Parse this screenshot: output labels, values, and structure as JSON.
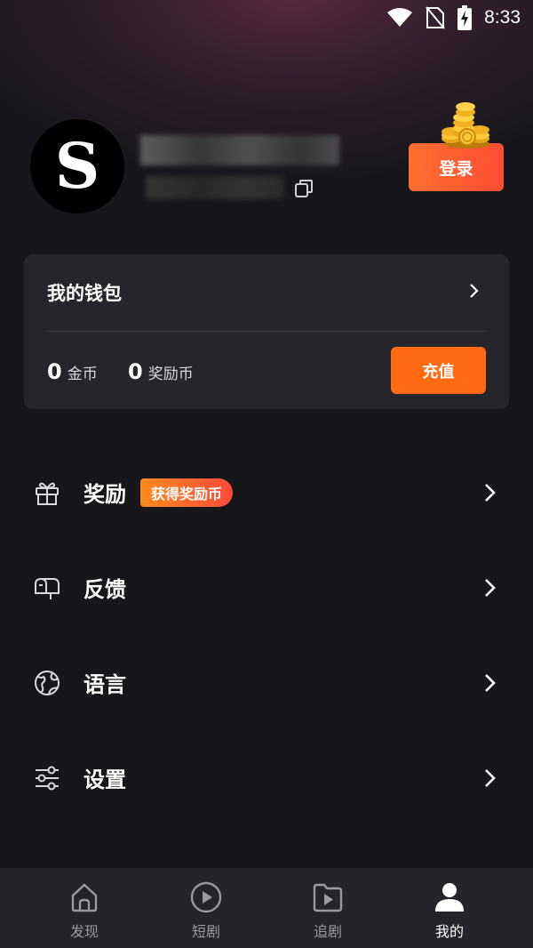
{
  "status_bar": {
    "time": "8:33",
    "icons": [
      "wifi-icon",
      "no-sim-icon",
      "battery-charging-icon"
    ]
  },
  "profile": {
    "avatar_letter": "S",
    "login_label": "登录"
  },
  "wallet": {
    "title": "我的钱包",
    "coins_value": "0",
    "coins_label": "金币",
    "reward_value": "0",
    "reward_label": "奖励币",
    "recharge_label": "充值"
  },
  "menu": {
    "items": [
      {
        "label": "奖励",
        "icon": "gift-icon",
        "badge": "获得奖励币"
      },
      {
        "label": "反馈",
        "icon": "mailbox-icon"
      },
      {
        "label": "语言",
        "icon": "globe-icon"
      },
      {
        "label": "设置",
        "icon": "sliders-icon"
      }
    ]
  },
  "tabbar": {
    "tabs": [
      {
        "label": "发现",
        "icon": "home-icon"
      },
      {
        "label": "短剧",
        "icon": "play-circle-icon"
      },
      {
        "label": "追剧",
        "icon": "folder-play-icon"
      },
      {
        "label": "我的",
        "icon": "person-icon",
        "active": true
      }
    ]
  },
  "colors": {
    "background": "#16161b",
    "card": "#25252b",
    "accent": "#ff6a12",
    "tabbar": "#24242a"
  }
}
